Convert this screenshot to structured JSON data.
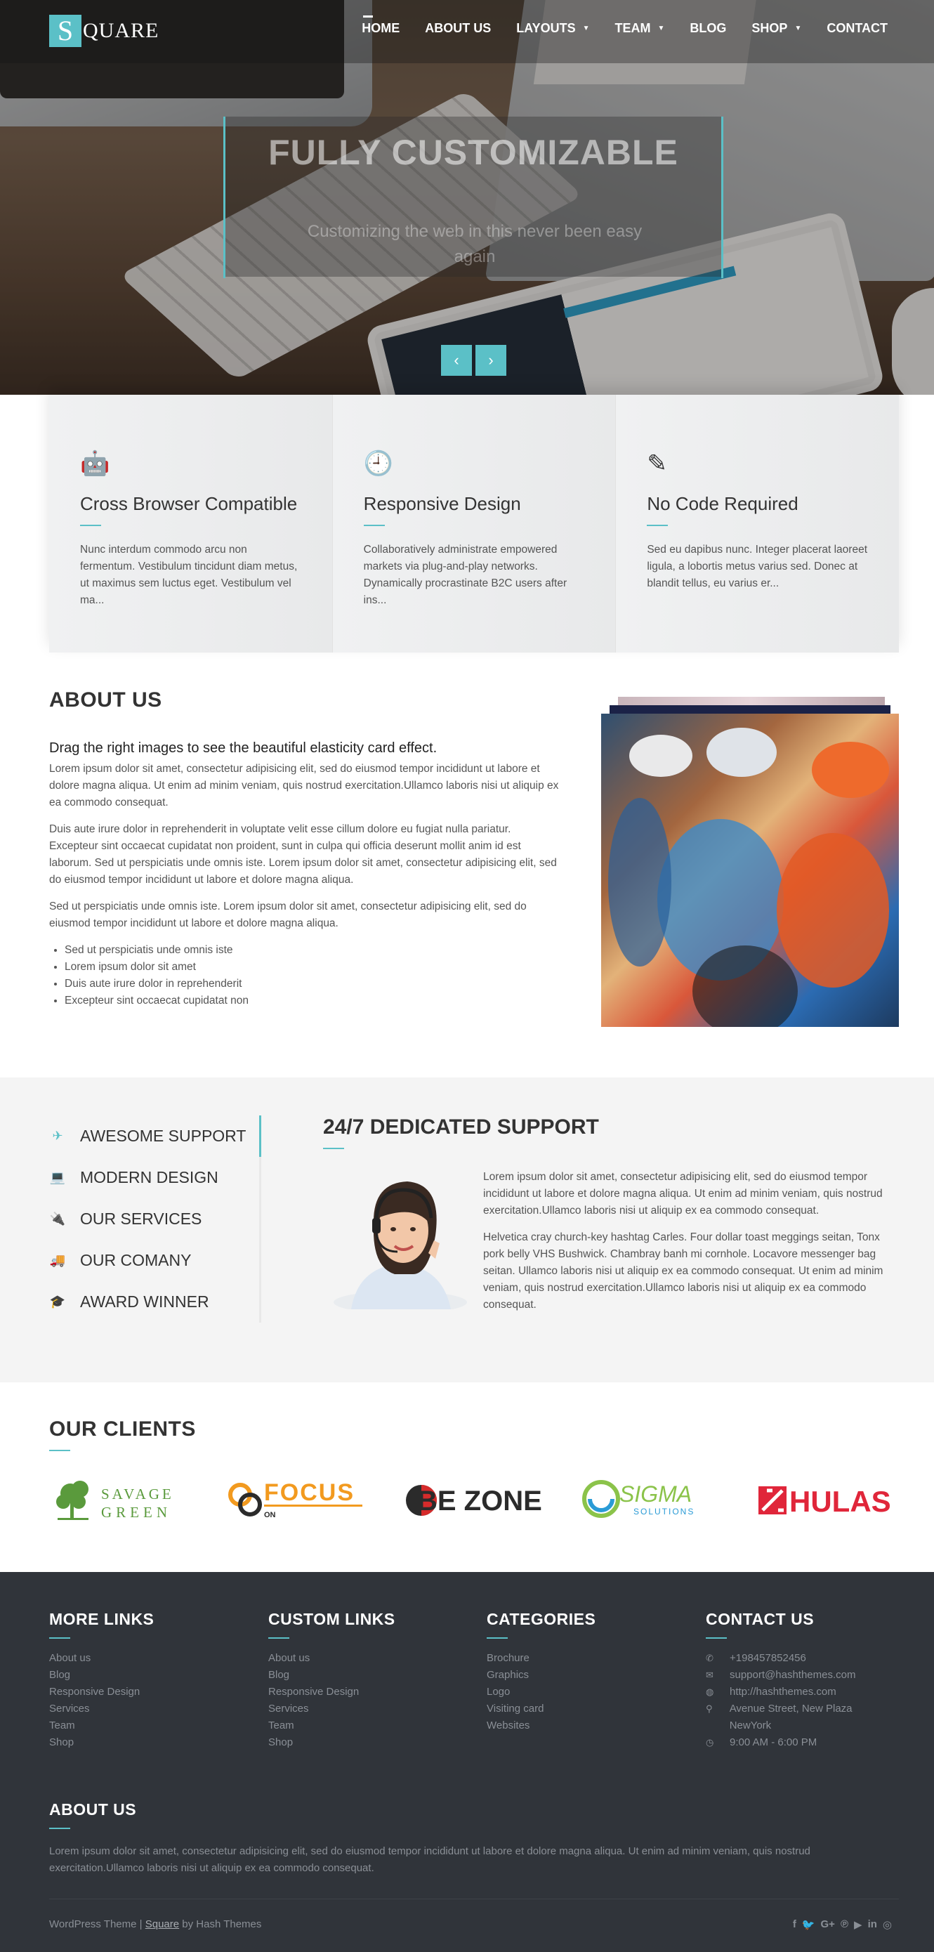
{
  "brand": {
    "logo_letter": "S",
    "logo_text": "QUARE",
    "accent": "#5bc0c7"
  },
  "nav": {
    "items": [
      {
        "label": "HOME",
        "dropdown": false
      },
      {
        "label": "ABOUT US",
        "dropdown": false
      },
      {
        "label": "LAYOUTS",
        "dropdown": true
      },
      {
        "label": "TEAM",
        "dropdown": true
      },
      {
        "label": "BLOG",
        "dropdown": false
      },
      {
        "label": "SHOP",
        "dropdown": true
      },
      {
        "label": "CONTACT",
        "dropdown": false
      }
    ]
  },
  "slider": {
    "title": "FULLY CUSTOMIZABLE",
    "subtitle": "Customizing the web in this never been easy again",
    "prev": "‹",
    "next": "›"
  },
  "features": [
    {
      "icon": "android-icon",
      "glyph": "🤖",
      "title": "Cross Browser Compatible",
      "text": "Nunc interdum commodo arcu non fermentum. Vestibulum tincidunt diam metus, ut maximus sem luctus eget. Vestibulum vel ma..."
    },
    {
      "icon": "clock-icon",
      "glyph": "🕘",
      "title": "Responsive Design",
      "text": "Collaboratively administrate empowered markets via plug-and-play networks. Dynamically procrastinate B2C users after ins..."
    },
    {
      "icon": "pencil-icon",
      "glyph": "✎",
      "title": "No Code Required",
      "text": "Sed eu dapibus nunc. Integer placerat laoreet ligula, a lobortis metus varius sed. Donec at blandit tellus, eu varius er..."
    }
  ],
  "about": {
    "title": "ABOUT US",
    "lead": "Drag the right images to see the beautiful elasticity card effect.",
    "paragraphs": [
      "Lorem ipsum dolor sit amet, consectetur adipisicing elit, sed do eiusmod tempor incididunt ut labore et dolore magna aliqua. Ut enim ad minim veniam, quis nostrud exercitation.Ullamco laboris nisi ut aliquip ex ea commodo consequat.",
      "Duis aute irure dolor in reprehenderit in voluptate velit esse cillum dolore eu fugiat nulla pariatur. Excepteur sint occaecat cupidatat non proident, sunt in culpa qui officia deserunt mollit anim id est laborum. Sed ut perspiciatis unde omnis iste. Lorem ipsum dolor sit amet, consectetur adipisicing elit, sed do eiusmod tempor incididunt ut labore et dolore magna aliqua.",
      "Sed ut perspiciatis unde omnis iste. Lorem ipsum dolor sit amet, consectetur adipisicing elit, sed do eiusmod tempor incididunt ut labore et dolore magna aliqua."
    ],
    "list": [
      "Sed ut perspiciatis unde omnis iste",
      "Lorem ipsum dolor sit amet",
      "Duis aute irure dolor in reprehenderit",
      "Excepteur sint occaecat cupidatat non"
    ]
  },
  "support": {
    "tabs": [
      {
        "icon": "plane-icon",
        "glyph": "✈",
        "label": "AWESOME SUPPORT",
        "active": true
      },
      {
        "icon": "laptop-icon",
        "glyph": "💻",
        "label": "MODERN DESIGN",
        "active": false
      },
      {
        "icon": "plug-icon",
        "glyph": "🔌",
        "label": "OUR SERVICES",
        "active": false
      },
      {
        "icon": "truck-icon",
        "glyph": "🚚",
        "label": "OUR COMANY",
        "active": false
      },
      {
        "icon": "graduation-cap-icon",
        "glyph": "🎓",
        "label": "AWARD WINNER",
        "active": false
      }
    ],
    "title": "24/7 DEDICATED SUPPORT",
    "paragraphs": [
      "Lorem ipsum dolor sit amet, consectetur adipisicing elit, sed do eiusmod tempor incididunt ut labore et dolore magna aliqua. Ut enim ad minim veniam, quis nostrud exercitation.Ullamco laboris nisi ut aliquip ex ea commodo consequat.",
      "Helvetica cray church-key hashtag Carles. Four dollar toast meggings seitan, Tonx pork belly VHS Bushwick. Chambray banh mi cornhole. Locavore messenger bag seitan. Ullamco laboris nisi ut aliquip ex ea commodo consequat. Ut enim ad minim veniam, quis nostrud exercitation.Ullamco laboris nisi ut aliquip ex ea commodo consequat."
    ]
  },
  "clients": {
    "title": "OUR CLIENTS",
    "logos": [
      {
        "name": "savage-green-logo",
        "line1": "SAVAGE",
        "line2": "GREEN",
        "color": "#5a9a3c"
      },
      {
        "name": "focus-logo",
        "text": "FOCUS",
        "sub": "ON",
        "color": "#f29a1f"
      },
      {
        "name": "be-zone-logo",
        "text": "BE ZONE",
        "color": "#2b2b2b",
        "accent": "#d62b2b"
      },
      {
        "name": "sigma-logo",
        "text": "SIGMA",
        "sub": "SOLUTIONS",
        "color": "#8bc34a",
        "accent": "#2a9bd6"
      },
      {
        "name": "hulas-logo",
        "text": "HULAS",
        "color": "#e0263a"
      }
    ]
  },
  "footer": {
    "more_links": {
      "title": "MORE LINKS",
      "items": [
        "About us",
        "Blog",
        "Responsive Design",
        "Services",
        "Team",
        "Shop"
      ]
    },
    "custom_links": {
      "title": "CUSTOM LINKS",
      "items": [
        "About us",
        "Blog",
        "Responsive Design",
        "Services",
        "Team",
        "Shop"
      ]
    },
    "categories": {
      "title": "CATEGORIES",
      "items": [
        "Brochure",
        "Graphics",
        "Logo",
        "Visiting card",
        "Websites"
      ]
    },
    "contact": {
      "title": "CONTACT US",
      "items": [
        {
          "icon": "phone-icon",
          "glyph": "✆",
          "text": "+198457852456"
        },
        {
          "icon": "envelope-icon",
          "glyph": "✉",
          "text": "support@hashthemes.com"
        },
        {
          "icon": "globe-icon",
          "glyph": "◍",
          "text": "http://hashthemes.com"
        },
        {
          "icon": "map-marker-icon",
          "glyph": "⚲",
          "text": "Avenue Street, New Plaza NewYork"
        },
        {
          "icon": "clock-icon",
          "glyph": "◷",
          "text": "9:00 AM - 6:00 PM"
        }
      ]
    },
    "about": {
      "title": "ABOUT US",
      "text": "Lorem ipsum dolor sit amet, consectetur adipisicing elit, sed do eiusmod tempor incididunt ut labore et dolore magna aliqua. Ut enim ad minim veniam, quis nostrud exercitation.Ullamco laboris nisi ut aliquip ex ea commodo consequat."
    },
    "credit": {
      "prefix": "WordPress Theme | ",
      "link": "Square",
      "suffix": " by Hash Themes"
    },
    "social": [
      {
        "icon": "facebook-icon",
        "glyph": "f"
      },
      {
        "icon": "twitter-icon",
        "glyph": "🐦"
      },
      {
        "icon": "google-plus-icon",
        "glyph": "G+"
      },
      {
        "icon": "pinterest-icon",
        "glyph": "℗"
      },
      {
        "icon": "youtube-icon",
        "glyph": "▶"
      },
      {
        "icon": "linkedin-icon",
        "glyph": "in"
      },
      {
        "icon": "instagram-icon",
        "glyph": "◎"
      }
    ]
  }
}
